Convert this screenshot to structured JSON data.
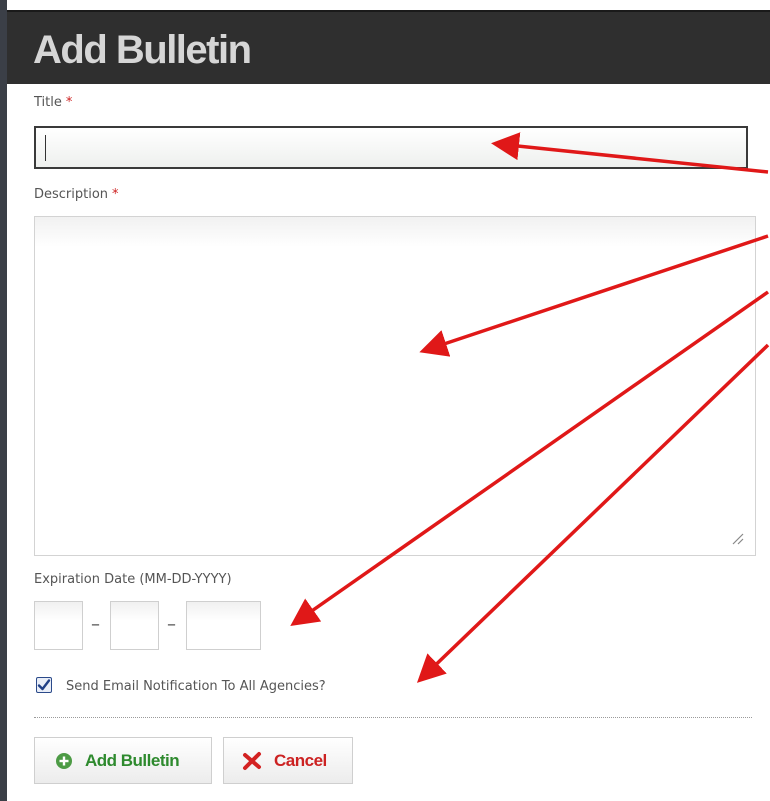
{
  "dialog": {
    "title": "Add Bulletin"
  },
  "form": {
    "title_label": "Title",
    "title_value": "",
    "description_label": "Description",
    "description_value": "",
    "required_marker": "*",
    "expiration_label": "Expiration Date (MM-DD-YYYY)",
    "date_separator": "–",
    "month_value": "",
    "day_value": "",
    "year_value": "",
    "email_label": "Send Email Notification To All Agencies?",
    "email_checked": true
  },
  "buttons": {
    "add_label": "Add Bulletin",
    "cancel_label": "Cancel"
  },
  "colors": {
    "title_bar": "#2f2f2f",
    "title_text": "#d6d6d6",
    "required": "#cc1f1f",
    "add_green": "#2e8a2e",
    "cancel_red": "#cc2222",
    "annotation_arrow": "#e01818"
  },
  "icons": {
    "add": "plus-circle-icon",
    "cancel": "x-icon",
    "resize": "resize-grip-icon",
    "check": "checkmark-icon"
  }
}
